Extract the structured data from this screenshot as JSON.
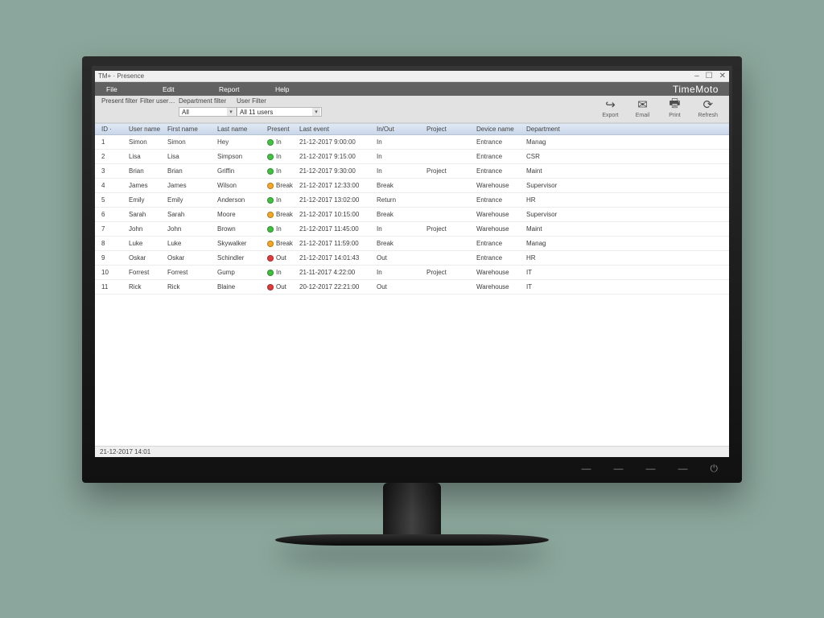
{
  "window": {
    "title": "TM+ · Presence",
    "brand": "TimeMoto"
  },
  "menu": {
    "file": "File",
    "edit": "Edit",
    "report": "Report",
    "help": "Help"
  },
  "filters": {
    "present_label": "Present filter",
    "filter_user_label": "Filter user…",
    "dept_label": "Department filter",
    "dept_value": "All",
    "user_filter_label": "User Filter",
    "user_filter_value": "All 11 users"
  },
  "toolbar": {
    "export": "Export",
    "email": "Email",
    "print": "Print",
    "refresh": "Refresh"
  },
  "columns": {
    "id": "ID  ·",
    "user_name": "User name",
    "first_name": "First name",
    "last_name": "Last name",
    "present": "Present",
    "last_event": "Last event",
    "inout": "In/Out",
    "project": "Project",
    "device": "Device name",
    "department": "Department"
  },
  "rows": [
    {
      "id": "1",
      "user": "Simon",
      "first": "Simon",
      "last": "Hey",
      "pcolor": "green",
      "plabel": "In",
      "lastevent": "21-12-2017 9:00:00",
      "inout": "In",
      "project": "",
      "device": "Entrance",
      "dept": "Manag"
    },
    {
      "id": "2",
      "user": "Lisa",
      "first": "Lisa",
      "last": "Simpson",
      "pcolor": "green",
      "plabel": "In",
      "lastevent": "21-12-2017 9:15:00",
      "inout": "In",
      "project": "",
      "device": "Entrance",
      "dept": "CSR"
    },
    {
      "id": "3",
      "user": "Brian",
      "first": "Brian",
      "last": "Griffin",
      "pcolor": "green",
      "plabel": "In",
      "lastevent": "21-12-2017 9:30:00",
      "inout": "In",
      "project": "Project",
      "device": "Entrance",
      "dept": "Maint"
    },
    {
      "id": "4",
      "user": "James",
      "first": "James",
      "last": "Wilson",
      "pcolor": "orange",
      "plabel": "Break",
      "lastevent": "21-12-2017 12:33:00",
      "inout": "Break",
      "project": "",
      "device": "Warehouse",
      "dept": "Supervisor"
    },
    {
      "id": "5",
      "user": "Emily",
      "first": "Emily",
      "last": "Anderson",
      "pcolor": "green",
      "plabel": "In",
      "lastevent": "21-12-2017 13:02:00",
      "inout": "Return",
      "project": "",
      "device": "Entrance",
      "dept": "HR"
    },
    {
      "id": "6",
      "user": "Sarah",
      "first": "Sarah",
      "last": "Moore",
      "pcolor": "orange",
      "plabel": "Break",
      "lastevent": "21-12-2017 10:15:00",
      "inout": "Break",
      "project": "",
      "device": "Warehouse",
      "dept": "Supervisor"
    },
    {
      "id": "7",
      "user": "John",
      "first": "John",
      "last": "Brown",
      "pcolor": "green",
      "plabel": "In",
      "lastevent": "21-12-2017 11:45:00",
      "inout": "In",
      "project": "Project",
      "device": "Warehouse",
      "dept": "Maint"
    },
    {
      "id": "8",
      "user": "Luke",
      "first": "Luke",
      "last": "Skywalker",
      "pcolor": "orange",
      "plabel": "Break",
      "lastevent": "21-12-2017 11:59:00",
      "inout": "Break",
      "project": "",
      "device": "Entrance",
      "dept": "Manag"
    },
    {
      "id": "9",
      "user": "Oskar",
      "first": "Oskar",
      "last": "Schindler",
      "pcolor": "red",
      "plabel": "Out",
      "lastevent": "21-12-2017 14:01:43",
      "inout": "Out",
      "project": "",
      "device": "Entrance",
      "dept": "HR"
    },
    {
      "id": "10",
      "user": "Forrest",
      "first": "Forrest",
      "last": "Gump",
      "pcolor": "green",
      "plabel": "In",
      "lastevent": "21-11-2017 4:22:00",
      "inout": "In",
      "project": "Project",
      "device": "Warehouse",
      "dept": "IT"
    },
    {
      "id": "11",
      "user": "Rick",
      "first": "Rick",
      "last": "Blaine",
      "pcolor": "red",
      "plabel": "Out",
      "lastevent": "20-12-2017 22:21:00",
      "inout": "Out",
      "project": "",
      "device": "Warehouse",
      "dept": "IT"
    }
  ],
  "statusbar": {
    "clock": "21-12-2017 14:01"
  }
}
